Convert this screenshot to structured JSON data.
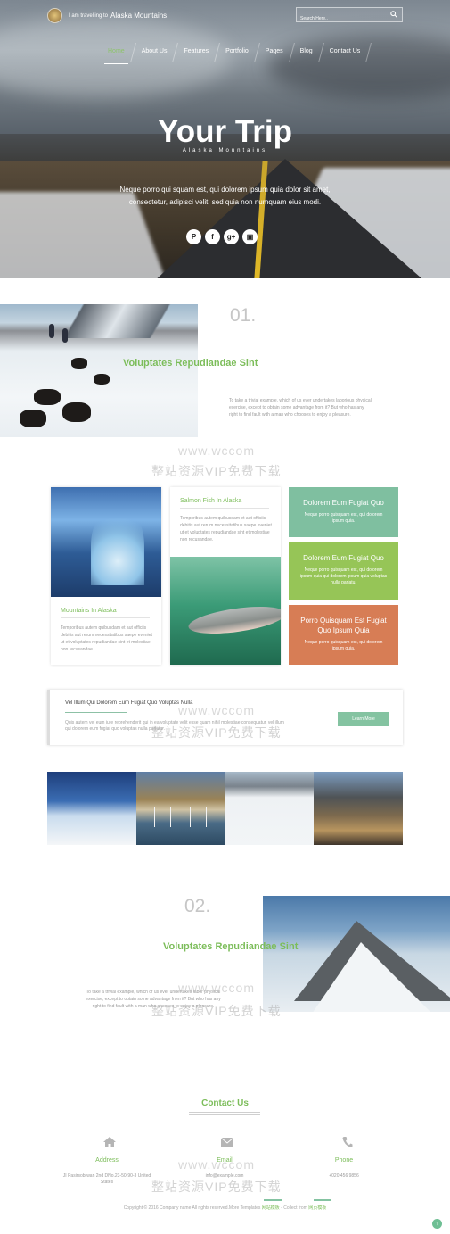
{
  "header": {
    "brand_prefix": "I am travelling to",
    "brand_name": "Alaska Mountains",
    "search_placeholder": "Search Here..",
    "nav": [
      "Home",
      "About Us",
      "Features",
      "Portfolio",
      "Pages",
      "Blog",
      "Contact Us"
    ],
    "active_nav": "Home"
  },
  "hero": {
    "title": "Your Trip",
    "subtitle": "Alaska Mountains",
    "text": "Neque porro qui squam est, qui dolorem ipsum quia dolor sit amet, consectetur, adipisci velit, sed quia non numquam eius modi.",
    "social": [
      "P",
      "f",
      "g+",
      "▣"
    ]
  },
  "section1": {
    "number": "01.",
    "title": "Voluptates Repudiandae Sint",
    "text": "To take a trivial example, which of us ever undertakes laborious physical exercise, except to obtain some advantage from it? But who has any right to find fault with a man who chooses to enjoy a pleasure."
  },
  "watermark": {
    "url": "www.wccom",
    "cn": "整站资源VIP免费下载"
  },
  "cards": {
    "mountains": {
      "title": "Mountains In Alaska",
      "text": "Temporibus autem quibusdam et aut officiis debitis aut rerum necessitatibus saepe eveniet ut et voluptates repudiandae sint et molestiae non recusandae."
    },
    "salmon": {
      "title": "Salmon Fish In Alaska",
      "text": "Temporibus autem quibusdam et aut officiis debitis aut rerum necessitatibus saepe eveniet ut et voluptates repudiandae sint et molestiae non recusandae."
    },
    "tiles": [
      {
        "title": "Dolorem Eum Fugiat Quo",
        "text": "Neque porro quisquam est, qui dolorem ipsum quia.",
        "color": "#7fbfa0"
      },
      {
        "title": "Dolorem Eum Fugiat Quo",
        "text": "Neque porro quisquam est, qui dolorem ipsum quia qui dolorem ipsum quia voluptas nulla pariatu.",
        "color": "#96c557"
      },
      {
        "title": "Porro Quisquam Est Fugiat Quo Ipsum Quia",
        "text": "Neque porro quisquam est, qui dolorem ipsum quia.",
        "color": "#d77d55"
      }
    ]
  },
  "banner": {
    "title": "Vel Illum Qui Dolorem Eum Fugiat Quo Voluptas Nulla",
    "text": "Quis autem vel eum iure reprehenderit qui in ea voluptate velit esse quam nihil molestiae consequatur, vel illum qui dolorem eum fugiat quo voluptas nulla pariatur.",
    "button": "Learn More"
  },
  "section2": {
    "number": "02.",
    "title": "Voluptates Repudiandae Sint",
    "text": "To take a trivial example, which of us ever undertakes labor physical exercise, except to obtain some advantage from it? But who has any right to find fault with a man who chooses to enjoy a pleasure."
  },
  "contact": {
    "title": "Contact Us",
    "items": [
      {
        "icon": "home-icon",
        "label": "Address",
        "value": "JI Pasirsobrwan 2nd DNo.23-50-90-3 United States"
      },
      {
        "icon": "envelope-icon",
        "label": "Email",
        "value": "info@example.com"
      },
      {
        "icon": "phone-icon",
        "label": "Phone",
        "value": "+020 456 9856"
      }
    ]
  },
  "footer": {
    "copyright_pre": "Copyright © 2016 Company name All rights reserved.More Templates",
    "link1": "网站模板",
    "copyright_mid": " - Collect from",
    "link2": "网页模板"
  }
}
